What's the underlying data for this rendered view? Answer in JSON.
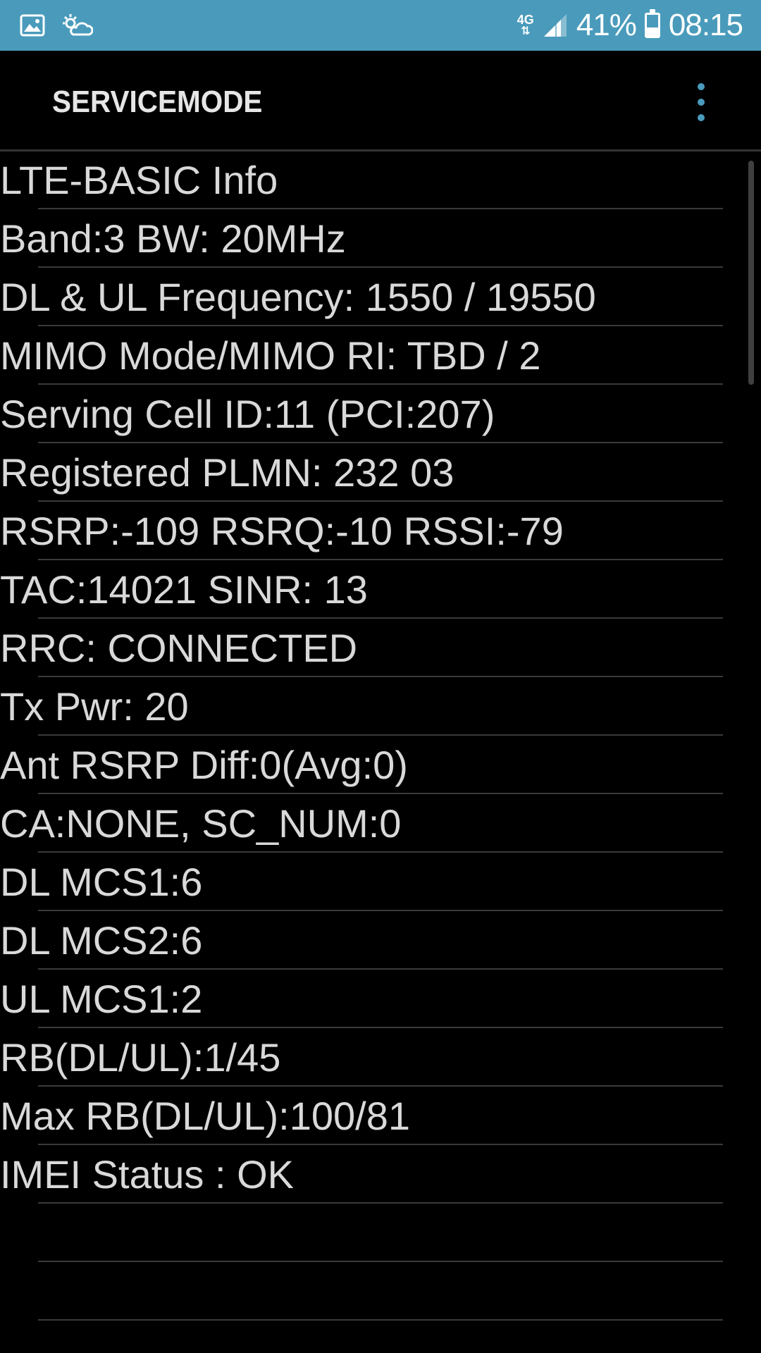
{
  "status_bar": {
    "network_type": "4G",
    "network_arrows": "⇅",
    "battery_text": "41%",
    "battery_level": 0.41,
    "time": "08:15",
    "left_icons": [
      "image-icon",
      "weather-icon"
    ]
  },
  "app_bar": {
    "title": "SERVICEMODE",
    "menu_icon": "more-vert-icon"
  },
  "rows": [
    "LTE-BASIC Info",
    "Band:3 BW: 20MHz",
    "DL & UL Frequency: 1550 / 19550",
    "MIMO Mode/MIMO RI: TBD / 2",
    "Serving Cell ID:11 (PCI:207)",
    "Registered PLMN: 232 03",
    "RSRP:-109 RSRQ:-10 RSSI:-79",
    "TAC:14021 SINR: 13",
    "RRC: CONNECTED",
    "Tx Pwr: 20",
    "Ant RSRP Diff:0(Avg:0)",
    "CA:NONE, SC_NUM:0",
    "DL MCS1:6",
    "DL MCS2:6",
    "UL MCS1:2",
    "RB(DL/UL):1/45",
    "Max RB(DL/UL):100/81",
    "IMEI Status : OK",
    "",
    ""
  ],
  "colors": {
    "status_bar": "#4a9bbb",
    "background": "#000000",
    "text": "#d9d9d9",
    "accent": "#4a9bbb"
  }
}
